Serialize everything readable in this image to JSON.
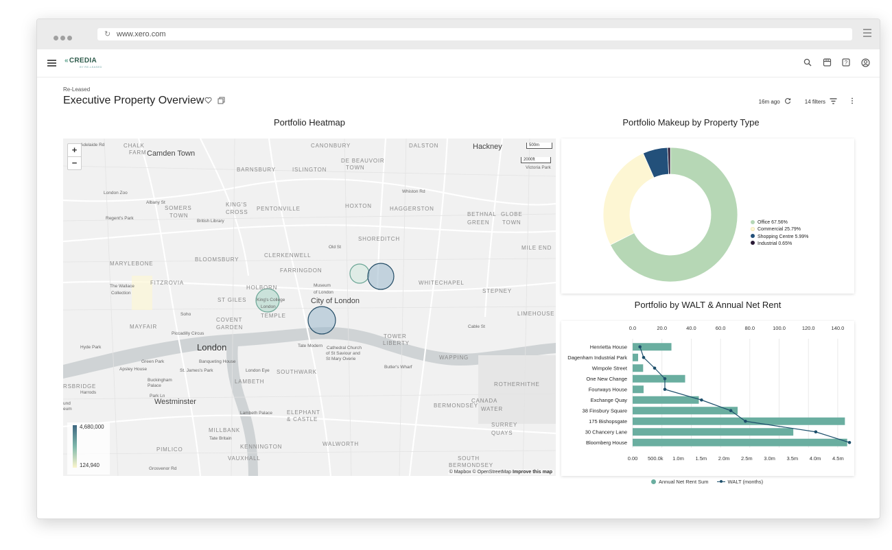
{
  "browser": {
    "url": "www.xero.com"
  },
  "app": {
    "logo_text": "CREDIA",
    "logo_sub": "BY RE-LEASED"
  },
  "header": {
    "breadcrumb": "Re-Leased",
    "title": "Executive Property Overview",
    "updated": "16m ago",
    "filters": "14 filters"
  },
  "icons": {
    "top": [
      "search-icon",
      "store-icon",
      "help-icon",
      "account-icon"
    ],
    "title": [
      "heart-icon",
      "copy-icon"
    ],
    "meta": [
      "refresh-icon",
      "filter-icon",
      "more-vert-icon"
    ]
  },
  "heatmap": {
    "title": "Portfolio Heatmap",
    "zoom_in": "+",
    "zoom_out": "−",
    "scale_metric": "500m",
    "scale_imperial": "2000ft",
    "legend_max": "4,680,000",
    "legend_min": "124,940",
    "attribution": "© Mapbox © OpenStreetMap",
    "attribution_link": "Improve this map",
    "places": [
      {
        "t": "Camden Town",
        "cls": "big"
      },
      {
        "t": "CANONBURY"
      },
      {
        "t": "DALSTON"
      },
      {
        "t": "Hackney",
        "cls": "big"
      },
      {
        "t": "BARNSBURY"
      },
      {
        "t": "ISLINGTON"
      },
      {
        "t": "DE BEAUVOIR"
      },
      {
        "t": "TOWN"
      },
      {
        "t": "London Zoo",
        "cls": "small"
      },
      {
        "t": "KING'S"
      },
      {
        "t": "CROSS"
      },
      {
        "t": "PENTONVILLE"
      },
      {
        "t": "HOXTON"
      },
      {
        "t": "HAGGERSTON"
      },
      {
        "t": "Whiston Rd",
        "cls": "small"
      },
      {
        "t": "SOMERS"
      },
      {
        "t": "TOWN"
      },
      {
        "t": "British Library",
        "cls": "small"
      },
      {
        "t": "BETHNAL"
      },
      {
        "t": "GREEN"
      },
      {
        "t": "GLOBE"
      },
      {
        "t": "TOWN"
      },
      {
        "t": "Regent's Park",
        "cls": "small"
      },
      {
        "t": "SHOREDITCH"
      },
      {
        "t": "Old St",
        "cls": "small"
      },
      {
        "t": "MILE END"
      },
      {
        "t": "MARYLEBONE"
      },
      {
        "t": "BLOOMSBURY"
      },
      {
        "t": "CLERKENWELL"
      },
      {
        "t": "FARRINGDON"
      },
      {
        "t": "FITZROVIA"
      },
      {
        "t": "The Wallace",
        "cls": "small"
      },
      {
        "t": "Collection",
        "cls": "small"
      },
      {
        "t": "WHITECHAPEL"
      },
      {
        "t": "STEPNEY"
      },
      {
        "t": "HOLBORN"
      },
      {
        "t": "Museum",
        "cls": "small"
      },
      {
        "t": "of London",
        "cls": "small"
      },
      {
        "t": "ST GILES"
      },
      {
        "t": "King's College",
        "cls": "small"
      },
      {
        "t": "London",
        "cls": "small"
      },
      {
        "t": "City of London",
        "cls": "big"
      },
      {
        "t": "Soho",
        "cls": "small"
      },
      {
        "t": "COVENT"
      },
      {
        "t": "GARDEN"
      },
      {
        "t": "TEMPLE"
      },
      {
        "t": "LIMEHOUSE"
      },
      {
        "t": "MAYFAIR"
      },
      {
        "t": "Piccadilly Circus",
        "cls": "small"
      },
      {
        "t": "Cable St",
        "cls": "small"
      },
      {
        "t": "TOWER"
      },
      {
        "t": "LIBERTY"
      },
      {
        "t": "London",
        "cls": "xl"
      },
      {
        "t": "Hyde Park",
        "cls": "small"
      },
      {
        "t": "Tate Modern",
        "cls": "small"
      },
      {
        "t": "Cathedral Church",
        "cls": "small"
      },
      {
        "t": "of St Saviour and",
        "cls": "small"
      },
      {
        "t": "St Mary Overie",
        "cls": "small"
      },
      {
        "t": "Green Park",
        "cls": "small"
      },
      {
        "t": "Banqueting House",
        "cls": "small"
      },
      {
        "t": "WAPPING"
      },
      {
        "t": "St. James's Park",
        "cls": "small"
      },
      {
        "t": "London Eye",
        "cls": "small"
      },
      {
        "t": "Apsley House",
        "cls": "small"
      },
      {
        "t": "SOUTHWARK"
      },
      {
        "t": "Butler's Wharf",
        "cls": "small"
      },
      {
        "t": "LAMBETH"
      },
      {
        "t": "Buckingham",
        "cls": "small"
      },
      {
        "t": "Palace",
        "cls": "small"
      },
      {
        "t": "ROTHERHITHE"
      },
      {
        "t": "RSBRIDGE"
      },
      {
        "t": "Harrods",
        "cls": "small"
      },
      {
        "t": "Westminster",
        "cls": "big"
      },
      {
        "t": "BERMONDSEY"
      },
      {
        "t": "CANADA"
      },
      {
        "t": "WATER"
      },
      {
        "t": "und",
        "cls": "small"
      },
      {
        "t": "eum",
        "cls": "small"
      },
      {
        "t": "Lambeth Palace",
        "cls": "small"
      },
      {
        "t": "ELEPHANT"
      },
      {
        "t": "& CASTLE"
      },
      {
        "t": "SURREY"
      },
      {
        "t": "QUAYS"
      },
      {
        "t": "MILLBANK"
      },
      {
        "t": "Tate Britain",
        "cls": "small"
      },
      {
        "t": "KENNINGTON"
      },
      {
        "t": "WALWORTH"
      },
      {
        "t": "PIMLICO"
      },
      {
        "t": "VAUXHALL"
      },
      {
        "t": "SOUTH"
      },
      {
        "t": "BERMONDSEY"
      },
      {
        "t": "Adelaide Rd",
        "cls": "small"
      },
      {
        "t": "CHALK"
      },
      {
        "t": "FARM"
      },
      {
        "t": "Victoria Park",
        "cls": "small"
      },
      {
        "t": "Albany St",
        "cls": "small"
      },
      {
        "t": "Grosvenor Rd",
        "cls": "small"
      },
      {
        "t": "Park Ln",
        "cls": "small"
      }
    ],
    "markers": [
      {
        "cx": 298,
        "cy": 236,
        "r": 17,
        "fill": "#a9d5c7",
        "stroke": "#6aa595"
      },
      {
        "cx": 432,
        "cy": 197,
        "r": 14,
        "fill": "#cfe7dc",
        "stroke": "#6aa595"
      },
      {
        "cx": 463,
        "cy": 201,
        "r": 19,
        "fill": "#9bb8cc",
        "stroke": "#234c66"
      },
      {
        "cx": 377,
        "cy": 265,
        "r": 20,
        "fill": "#9bb8cc",
        "stroke": "#234c66"
      }
    ]
  },
  "donut": {
    "title": "Portfolio Makeup by Property Type",
    "legend": [
      {
        "label": "Office 67.56%",
        "color": "#b6d7b5"
      },
      {
        "label": "Commercial 25.79%",
        "color": "#fdf6d3"
      },
      {
        "label": "Shopping Centre 5.99%",
        "color": "#23507a"
      },
      {
        "label": "Industrial 0.65%",
        "color": "#2a1a36"
      }
    ]
  },
  "bar_chart": {
    "title": "Portfolio by WALT & Annual Net Rent",
    "legend_bar": "Annual Net Rent Sum",
    "legend_line": "WALT (months)"
  },
  "chart_data": [
    {
      "type": "pie",
      "categories": [
        "Office",
        "Commercial",
        "Shopping Centre",
        "Industrial"
      ],
      "values": [
        67.56,
        25.79,
        5.99,
        0.65
      ],
      "colors": [
        "#b6d7b5",
        "#fdf6d3",
        "#23507a",
        "#2a1a36"
      ],
      "title": "Portfolio Makeup by Property Type",
      "legend": "right"
    },
    {
      "type": "bar",
      "orientation": "horizontal",
      "title": "Portfolio by WALT & Annual Net Rent",
      "categories": [
        "Henrietta House",
        "Dagenham Industrial Park",
        "Wimpole Street",
        "One New Change",
        "Fourways House",
        "Exchange Quay",
        "38 Finsbury Square",
        "175 Bishopsgate",
        "30 Chancery Lane",
        "Bloomberg House"
      ],
      "series": [
        {
          "name": "Annual Net Rent Sum",
          "type": "bar",
          "values": [
            850000,
            120000,
            230000,
            1150000,
            240000,
            1450000,
            2300000,
            4650000,
            3520000,
            4700000
          ],
          "color": "#6aaea0"
        },
        {
          "name": "WALT (months)",
          "type": "line",
          "values": [
            5,
            7.5,
            15,
            22,
            22,
            47,
            67,
            77,
            125,
            148
          ],
          "color": "#1d4f6b"
        }
      ],
      "x_bottom_ticks": [
        "0.00",
        "500.0k",
        "1.0m",
        "1.5m",
        "2.0m",
        "2.5m",
        "3.0m",
        "3.5m",
        "4.0m",
        "4.5m"
      ],
      "x_bottom_range": [
        0,
        4750000
      ],
      "x_top_ticks": [
        "0.0",
        "20.0",
        "40.0",
        "60.0",
        "80.0",
        "100.0",
        "120.0",
        "140.0"
      ],
      "x_top_range": [
        0,
        148
      ],
      "grid": true,
      "legend": "bottom"
    }
  ]
}
